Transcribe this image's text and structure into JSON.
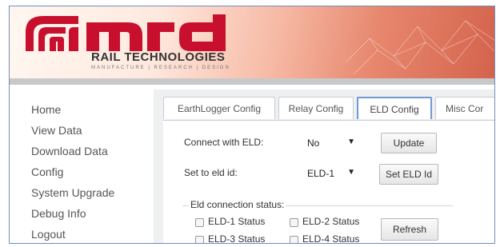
{
  "header": {
    "brand": "mrd",
    "subtitle": "RAIL TECHNOLOGIES",
    "tagline": "MANUFACTURE | RESEARCH | DESIGN"
  },
  "sidebar": {
    "items": [
      {
        "label": "Home"
      },
      {
        "label": "View Data"
      },
      {
        "label": "Download Data"
      },
      {
        "label": "Config"
      },
      {
        "label": "System Upgrade"
      },
      {
        "label": "Debug Info"
      },
      {
        "label": "Logout"
      }
    ]
  },
  "tabs": [
    {
      "label": "EarthLogger Config"
    },
    {
      "label": "Relay Config"
    },
    {
      "label": "ELD Config",
      "active": true
    },
    {
      "label": "Misc Cor"
    }
  ],
  "eld": {
    "connect_label": "Connect with ELD:",
    "connect_value": "No",
    "update_label": "Update",
    "setid_label": "Set to eld id:",
    "setid_value": "ELD-1",
    "setid_button": "Set ELD Id",
    "status_legend": "Eld connection status:",
    "status": [
      {
        "label": "ELD-1 Status"
      },
      {
        "label": "ELD-2 Status"
      },
      {
        "label": "ELD-3 Status"
      },
      {
        "label": "ELD-4 Status"
      }
    ],
    "refresh_label": "Refresh"
  },
  "colors": {
    "brand_red": "#c8102e",
    "active_tab_border": "#6f9ad6",
    "panel_bg": "#eef0f2"
  }
}
